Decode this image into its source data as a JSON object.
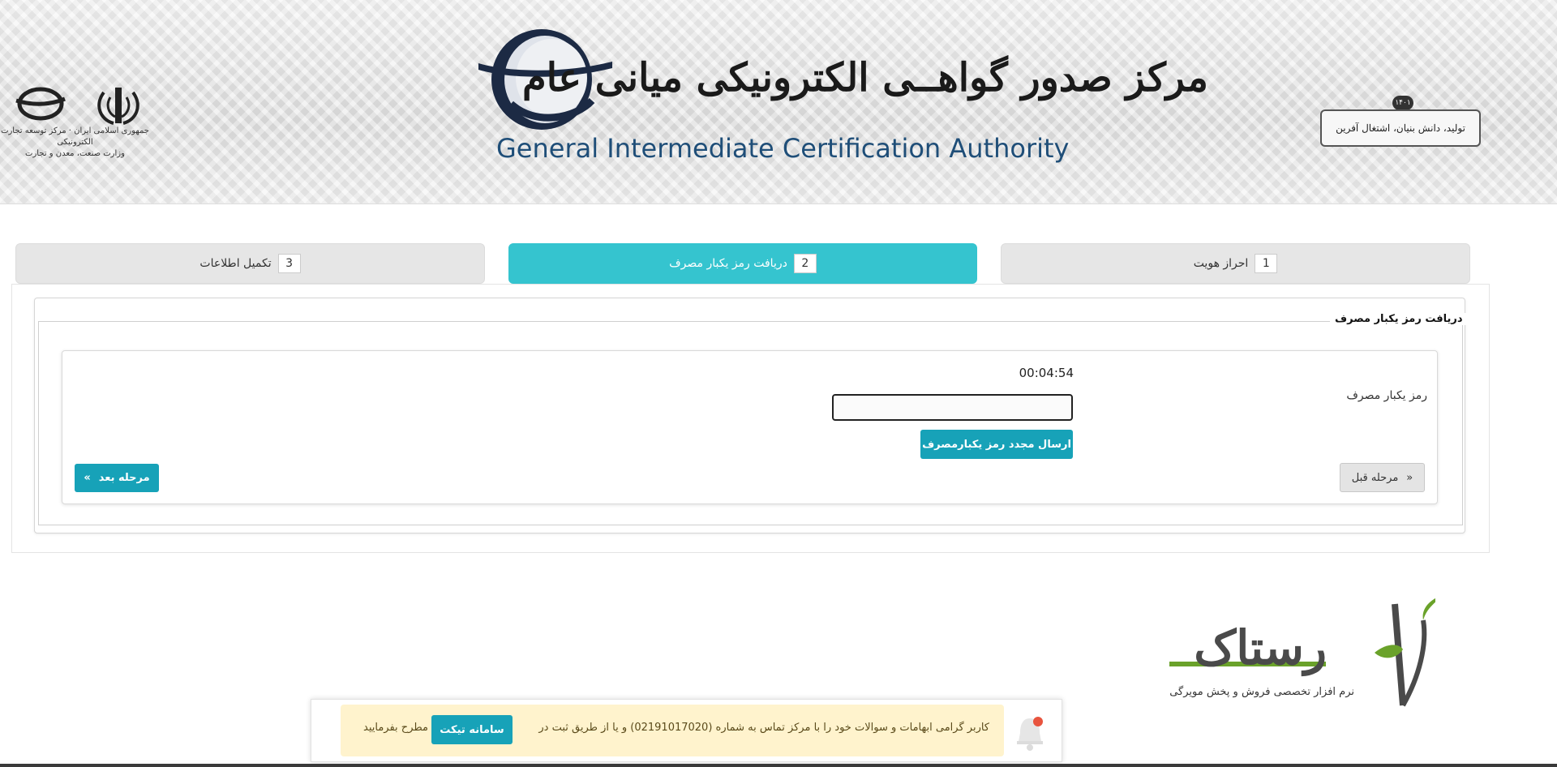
{
  "header": {
    "title_fa": "مرکز صدور گواهــی الکترونیکی میانی عام",
    "title_en": "General Intermediate Certification Authority",
    "ministry_text_line1": "جمهوری اسلامی ایران · مرکز توسعه تجارت الکترونیکی",
    "ministry_text_line2": "وزارت صنعت، معدن و تجارت",
    "slogan": "تولید، دانش بنیان، اشتغال آفرین",
    "slogan_year": "۱۴۰۱"
  },
  "steps": [
    {
      "number": "1",
      "label": "احراز هویت",
      "active": false
    },
    {
      "number": "2",
      "label": "دریافت رمز یکبار مصرف",
      "active": true
    },
    {
      "number": "3",
      "label": "تکمیل اطلاعات",
      "active": false
    }
  ],
  "form": {
    "section_title": "دریافت رمز یکبار مصرف",
    "otp_label": "رمز یکبار مصرف",
    "otp_value": "",
    "otp_placeholder": "",
    "timer": "00:04:54",
    "resend_label": "ارسال مجدد رمز یکبارمصرف",
    "next_label": "مرحله بعد",
    "next_arrow": "»",
    "prev_label": "مرحله قبل",
    "prev_arrow": "«"
  },
  "watermark": {
    "word": "رستاک",
    "tagline": "نرم افزار تخصصی فروش و پخش مویرگی"
  },
  "notification": {
    "text_part1": "کاربر گرامی ابهامات و سوالات خود را با مرکز تماس به شماره (02191017020) و یا از طریق ثبت در",
    "ticket_label": "سامانه تیکت",
    "text_part2": "مطرح بفرمایید"
  },
  "colors": {
    "accent": "#17a2b8",
    "active_tab": "#35c4cf",
    "notification_bg": "#fff3cd"
  }
}
